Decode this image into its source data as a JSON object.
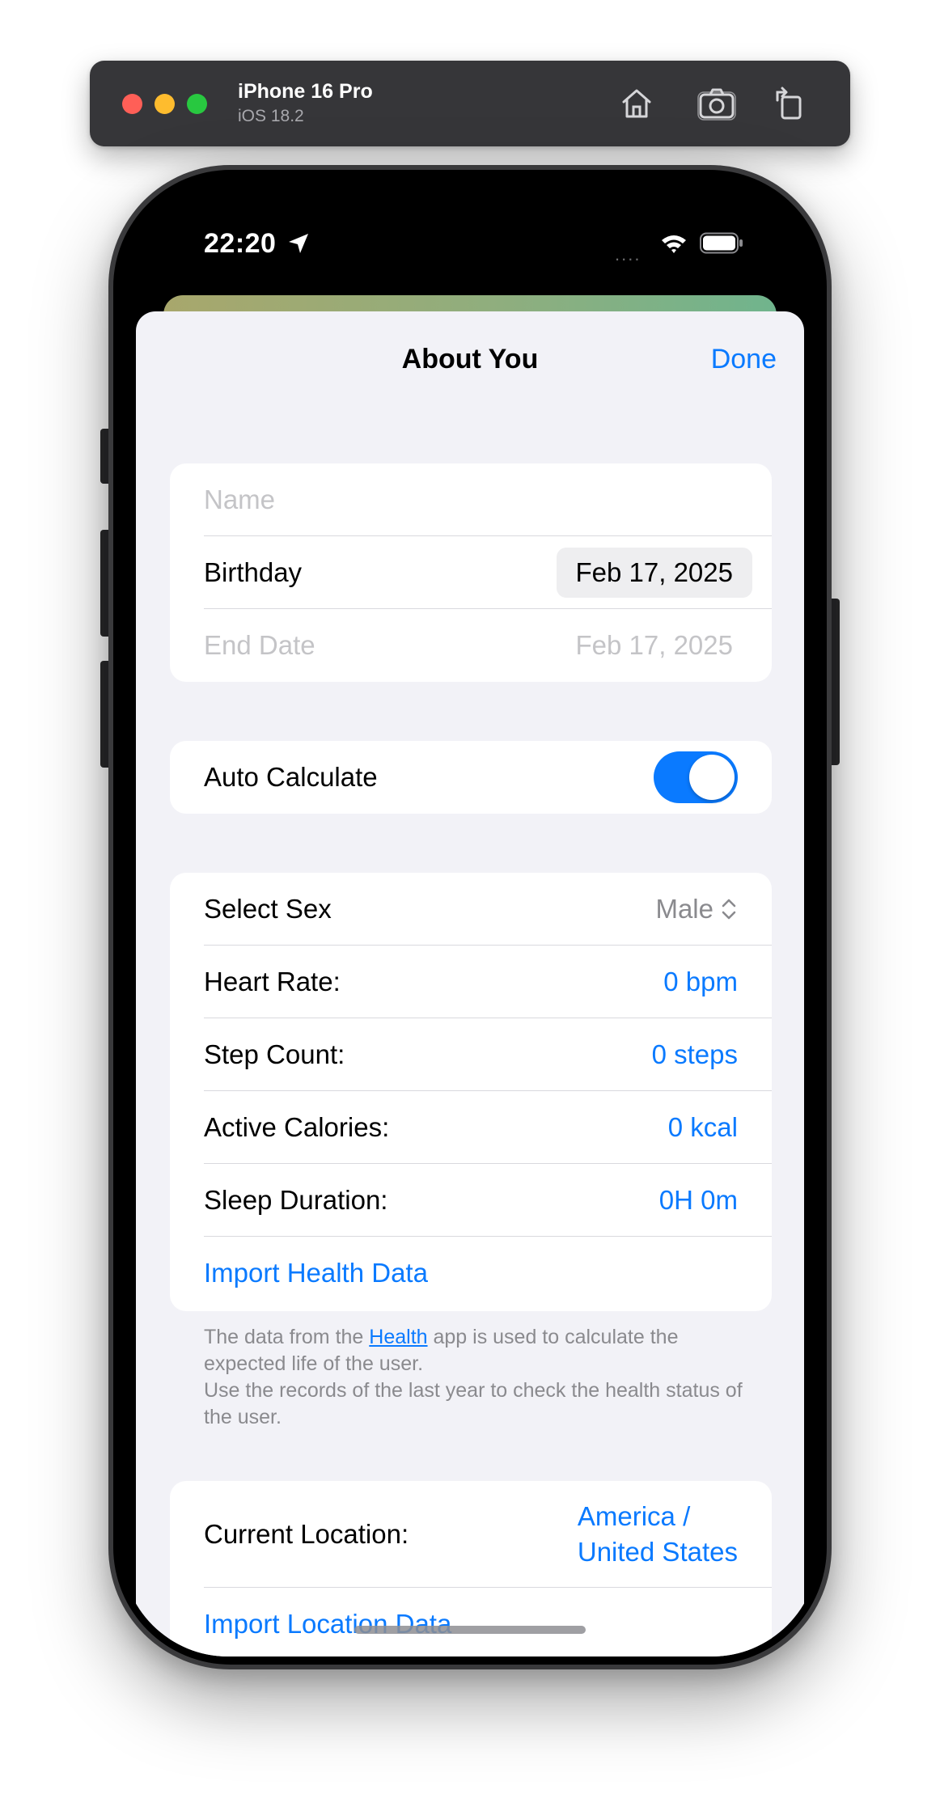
{
  "simulator": {
    "device_name": "iPhone 16 Pro",
    "os_version": "iOS 18.2",
    "icons": [
      "home-icon",
      "screenshot-icon",
      "rotate-icon"
    ]
  },
  "status_bar": {
    "time": "22:20",
    "signal": "....",
    "icons": [
      "location-arrow-icon",
      "wifi-icon",
      "battery-icon"
    ]
  },
  "nav": {
    "title": "About You",
    "done": "Done"
  },
  "profile": {
    "name_placeholder": "Name",
    "birthday_label": "Birthday",
    "birthday_value": "Feb 17, 2025",
    "end_date_label": "End Date",
    "end_date_value": "Feb 17, 2025"
  },
  "auto_calculate": {
    "label": "Auto Calculate",
    "on": true
  },
  "health": {
    "sex_label": "Select Sex",
    "sex_value": "Male",
    "heart_rate_label": "Heart Rate:",
    "heart_rate_value": "0 bpm",
    "step_count_label": "Step Count:",
    "step_count_value": "0 steps",
    "active_calories_label": "Active Calories:",
    "active_calories_value": "0 kcal",
    "sleep_label": "Sleep Duration:",
    "sleep_value": "0H 0m",
    "import_label": "Import Health Data"
  },
  "footnote": {
    "prefix": "The data from the ",
    "link": "Health",
    "suffix": " app is used to calculate the expected life of the user.",
    "line2": "Use the records of the last year to check the health status of the user."
  },
  "location": {
    "current_label": "Current Location:",
    "current_value_line1": "America /",
    "current_value_line2": "United States",
    "import_label": "Import Location Data"
  },
  "colors": {
    "accent": "#0a7aff",
    "background": "#f2f2f7",
    "toolbar": "#363639"
  }
}
